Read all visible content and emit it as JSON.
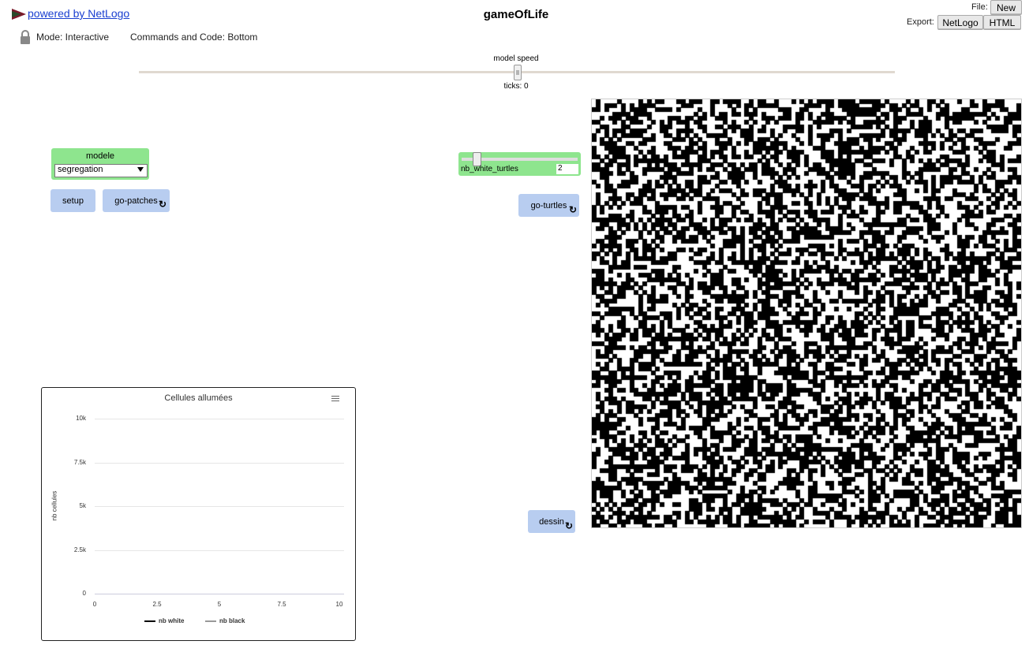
{
  "header": {
    "powered_by": "powered by NetLogo",
    "model_title": "gameOfLife",
    "mode_label": "Mode: Interactive",
    "commands_label": "Commands and Code: Bottom",
    "file_label": "File:",
    "new_label": "New",
    "export_label": "Export:",
    "export_netlogo": "NetLogo",
    "export_html": "HTML"
  },
  "speed": {
    "label": "model speed",
    "ticks": "ticks: 0",
    "value": 0.5
  },
  "widgets": {
    "chooser": {
      "label": "modele",
      "value": "segregation"
    },
    "setup": "setup",
    "go_patches": "go-patches",
    "slider": {
      "label": "nb_white_turtles",
      "value": "2",
      "fraction": 0.12
    },
    "go_turtles": "go-turtles",
    "dessin": "dessin"
  },
  "plot": {
    "menu_icon": "hamburger-menu-icon",
    "chart_data": {
      "type": "line",
      "title": "Cellules allumées",
      "xlabel": "",
      "ylabel": "nb cellules",
      "xlim": [
        0,
        10
      ],
      "ylim": [
        0,
        10000
      ],
      "x_ticks": [
        "0",
        "2.5",
        "5",
        "7.5",
        "10"
      ],
      "y_ticks": [
        "0",
        "2.5k",
        "5k",
        "7.5k",
        "10k"
      ],
      "grid": true,
      "legend_position": "bottom",
      "series": [
        {
          "name": "nb white",
          "color": "#000000",
          "values": []
        },
        {
          "name": "nb black",
          "color": "#999999",
          "values": []
        }
      ]
    }
  },
  "colors": {
    "button": "#b8cdf0",
    "input_widget": "#8ee58e",
    "link": "#1a3fd0"
  }
}
